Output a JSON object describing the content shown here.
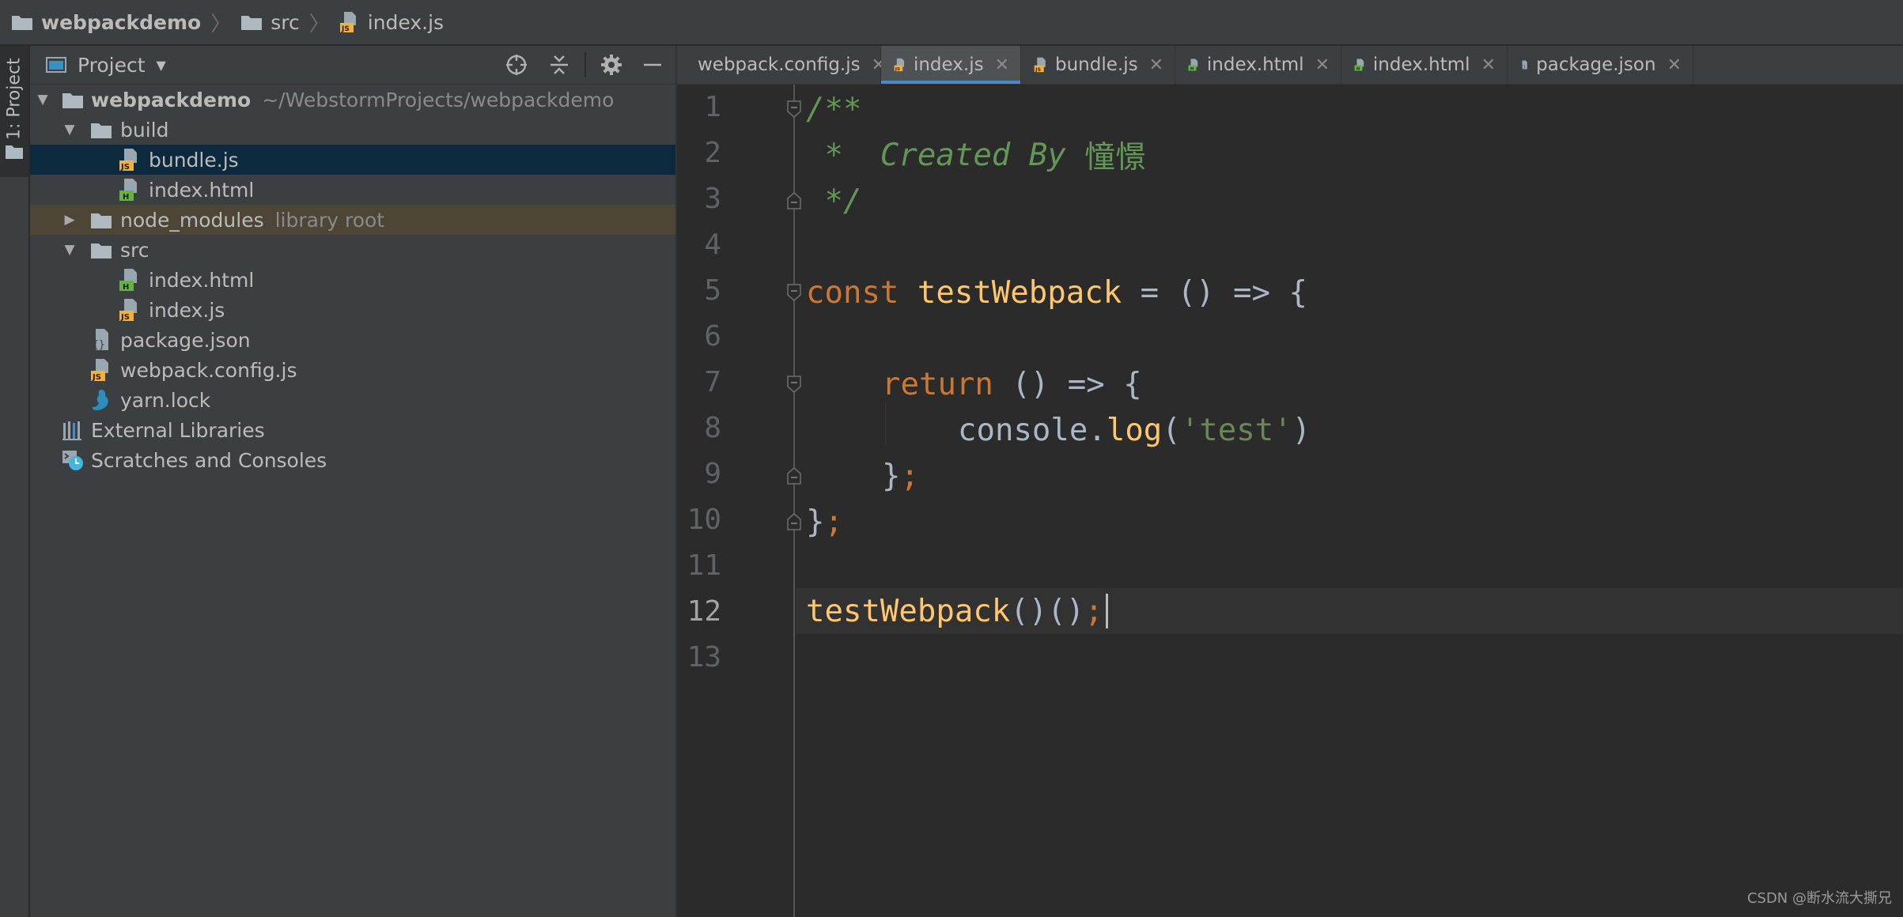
{
  "breadcrumb": {
    "project": "webpackdemo",
    "folder": "src",
    "file": "index.js"
  },
  "tool_stripe": {
    "label": "1: Project"
  },
  "project_panel": {
    "title": "Project",
    "tree": [
      {
        "label": "webpackdemo",
        "hint": "~/WebstormProjects/webpackdemo",
        "icon": "folder-icon",
        "expanded": true
      },
      {
        "label": "build",
        "icon": "folder-icon",
        "expanded": true
      },
      {
        "label": "bundle.js",
        "icon": "js-file-icon",
        "selected": true
      },
      {
        "label": "index.html",
        "icon": "html-file-icon"
      },
      {
        "label": "node_modules",
        "hint": "library root",
        "icon": "folder-icon",
        "expanded": false
      },
      {
        "label": "src",
        "icon": "folder-icon",
        "expanded": true
      },
      {
        "label": "index.html",
        "icon": "html-file-icon"
      },
      {
        "label": "index.js",
        "icon": "js-file-icon"
      },
      {
        "label": "package.json",
        "icon": "json-file-icon"
      },
      {
        "label": "webpack.config.js",
        "icon": "js-file-icon"
      },
      {
        "label": "yarn.lock",
        "icon": "yarn-icon"
      },
      {
        "label": "External Libraries",
        "icon": "libraries-icon"
      },
      {
        "label": "Scratches and Consoles",
        "icon": "scratches-icon"
      }
    ]
  },
  "tabs": [
    {
      "label": "webpack.config.js",
      "icon": "js-file-icon"
    },
    {
      "label": "index.js",
      "icon": "js-file-icon",
      "active": true
    },
    {
      "label": "bundle.js",
      "icon": "js-file-icon"
    },
    {
      "label": "index.html",
      "icon": "html-file-icon"
    },
    {
      "label": "index.html",
      "icon": "html-file-icon"
    },
    {
      "label": "package.json",
      "icon": "json-file-icon"
    }
  ],
  "editor": {
    "line_numbers": [
      "1",
      "2",
      "3",
      "4",
      "5",
      "6",
      "7",
      "8",
      "9",
      "10",
      "11",
      "12",
      "13"
    ],
    "current_line": "12",
    "code": {
      "l1_comment": "/**",
      "l2_star": " *  ",
      "l2_text": "Created By ",
      "l2_name": "憧憬",
      "l3_comment": " */",
      "l5_kw": "const",
      "l5_name": "testWebpack",
      "l5_rest": " = () => {",
      "l7_kw": "return",
      "l7_rest": " () => {",
      "l8_obj": "console.",
      "l8_fn": "log",
      "l8_open": "(",
      "l8_str": "'test'",
      "l8_close": ")",
      "l9_brace": "}",
      "l9_semi": ";",
      "l10_brace": "}",
      "l10_semi": ";",
      "l12_fn": "testWebpack",
      "l12_parens": "()()",
      "l12_semi": ";"
    }
  },
  "watermark": "CSDN @断水流大撕兄",
  "colors": {
    "keyword": "#cc7832",
    "function": "#ffc66d",
    "string": "#6a8759",
    "comment": "#629755",
    "selection": "#0d293e",
    "active_tab_underline": "#4a88c7"
  }
}
